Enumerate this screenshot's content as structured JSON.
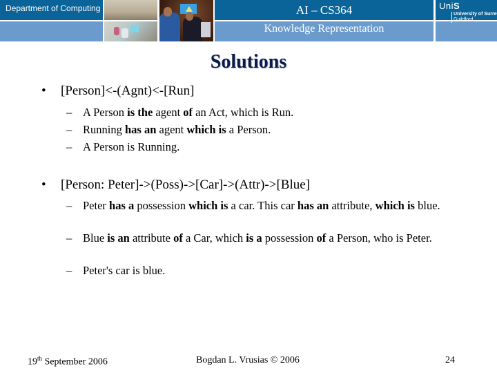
{
  "header": {
    "department": "Department of Computing",
    "course_title": "AI – CS364",
    "course_subtitle": "Knowledge Representation",
    "logo": {
      "uni_prefix": "Uni",
      "uni_suffix": "S",
      "university": "University of Surrey",
      "location": "Guildford"
    },
    "colors": {
      "dark_band": "#0b6499",
      "light_band": "#6b9bcc"
    }
  },
  "slide": {
    "title": "Solutions",
    "bullets": [
      {
        "text": "[Person]<-(Agnt)<-[Run]",
        "subs": [
          [
            {
              "t": "A Person ",
              "b": false
            },
            {
              "t": "is the",
              "b": true
            },
            {
              "t": " agent ",
              "b": false
            },
            {
              "t": "of",
              "b": true
            },
            {
              "t": " an Act, which is Run.",
              "b": false
            }
          ],
          [
            {
              "t": "Running ",
              "b": false
            },
            {
              "t": "has an",
              "b": true
            },
            {
              "t": " agent ",
              "b": false
            },
            {
              "t": "which is",
              "b": true
            },
            {
              "t": " a Person.",
              "b": false
            }
          ],
          [
            {
              "t": "A Person is Running.",
              "b": false
            }
          ]
        ]
      },
      {
        "text": "[Person: Peter]->(Poss)->[Car]->(Attr)->[Blue]",
        "subs": [
          [
            {
              "t": "Peter ",
              "b": false
            },
            {
              "t": "has a",
              "b": true
            },
            {
              "t": " possession ",
              "b": false
            },
            {
              "t": "which is",
              "b": true
            },
            {
              "t": " a car. This car ",
              "b": false
            },
            {
              "t": "has an",
              "b": true
            },
            {
              "t": " attribute, ",
              "b": false
            },
            {
              "t": "which is",
              "b": true
            },
            {
              "t": " blue.",
              "b": false
            }
          ],
          [
            {
              "t": "Blue ",
              "b": false
            },
            {
              "t": "is an",
              "b": true
            },
            {
              "t": " attribute ",
              "b": false
            },
            {
              "t": "of",
              "b": true
            },
            {
              "t": " a Car, which ",
              "b": false
            },
            {
              "t": "is a",
              "b": true
            },
            {
              "t": " possession ",
              "b": false
            },
            {
              "t": "of",
              "b": true
            },
            {
              "t": " a Person, who is Peter.",
              "b": false
            }
          ],
          [
            {
              "t": "Peter's car is blue.",
              "b": false
            }
          ]
        ]
      }
    ]
  },
  "footer": {
    "date_day": "19",
    "date_suffix": "th",
    "date_rest": " September 2006",
    "author": "Bogdan L. Vrusias © 2006",
    "page_number": "24"
  }
}
